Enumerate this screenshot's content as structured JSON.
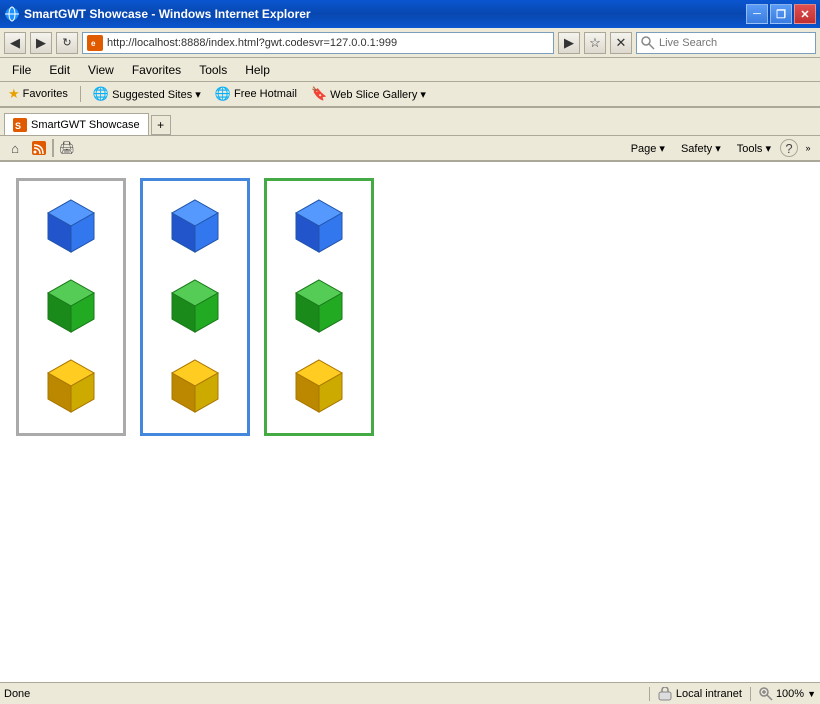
{
  "titleBar": {
    "title": "SmartGWT Showcase - Windows Internet Explorer",
    "minimizeLabel": "─",
    "restoreLabel": "❐",
    "closeLabel": "✕"
  },
  "addressBar": {
    "url": "http://localhost:8888/index.html?gwt.codesvr=127.0.0.1:999",
    "searchPlaceholder": "Live Search",
    "searchLabel": "Search"
  },
  "menuBar": {
    "items": [
      "File",
      "Edit",
      "View",
      "Favorites",
      "Tools",
      "Help"
    ]
  },
  "favBar": {
    "favoritesLabel": "Favorites",
    "suggestedLabel": "Suggested Sites ▾",
    "hotmailLabel": "Free Hotmail",
    "webSliceLabel": "Web Slice Gallery ▾"
  },
  "tabBar": {
    "tab": "SmartGWT Showcase",
    "newTabTitle": "+"
  },
  "toolbar": {
    "homeLabel": "⌂",
    "feedLabel": "🔔",
    "printLabel": "🖨",
    "pageLabel": "Page ▾",
    "safetyLabel": "Safety ▾",
    "toolsLabel": "Tools ▾",
    "helpLabel": "?"
  },
  "cards": [
    {
      "borderClass": "gray-border",
      "id": "card-gray"
    },
    {
      "borderClass": "blue-border",
      "id": "card-blue"
    },
    {
      "borderClass": "green-border",
      "id": "card-green"
    }
  ],
  "statusBar": {
    "statusText": "Done",
    "zoneLabel": "Local intranet",
    "zoomLabel": "100%"
  }
}
